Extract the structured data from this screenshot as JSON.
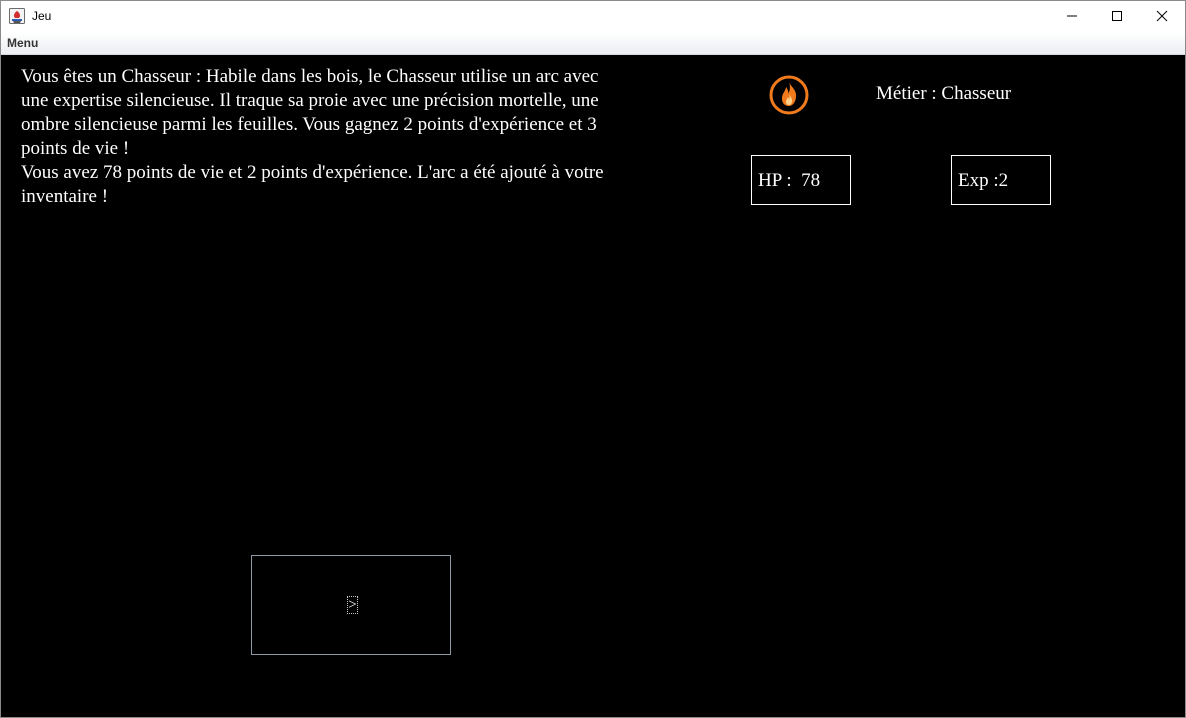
{
  "window": {
    "title": "Jeu",
    "icon": "java-app-icon"
  },
  "window_controls": [
    "minimize-icon",
    "maximize-icon",
    "close-icon"
  ],
  "menubar": {
    "items": [
      {
        "label": "Menu"
      }
    ]
  },
  "narrative": {
    "paragraph1": "Vous êtes un Chasseur : Habile dans les bois, le Chasseur utilise un arc avec une expertise silencieuse. Il traque sa proie avec une précision mortelle, une ombre silencieuse parmi les feuilles. Vous gagnez 2 points d'expérience et 3 points de vie !",
    "paragraph2": "Vous avez 78 points de vie et 2 points d'expérience. L'arc a été ajouté à votre inventaire !"
  },
  "status": {
    "job_icon": "fire-icon",
    "job_label": "Métier : Chasseur",
    "hp_text": "HP :  78",
    "exp_text": "Exp :2",
    "hp_value": 78,
    "exp_value": 2
  },
  "action": {
    "label": ">"
  },
  "colors": {
    "background": "#000000",
    "text": "#ffffff",
    "fire_accent": "#f07a1c"
  }
}
